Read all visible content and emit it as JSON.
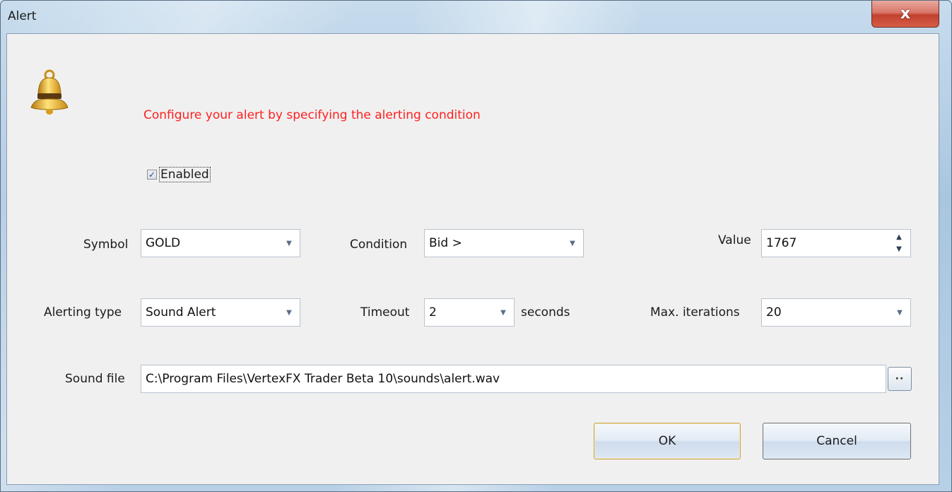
{
  "window": {
    "title": "Alert",
    "close_glyph": "x"
  },
  "header": {
    "icon": "bell-icon",
    "message": "Configure your alert by specifying the alerting condition",
    "message_color": "#ff2020"
  },
  "enabled": {
    "label": "Enabled",
    "checked": true,
    "check_glyph": "✓"
  },
  "symbol": {
    "label": "Symbol",
    "value": "GOLD"
  },
  "condition": {
    "label": "Condition",
    "value": "Bid >"
  },
  "value_field": {
    "label": "Value",
    "value": "1767"
  },
  "alerting_type": {
    "label": "Alerting type",
    "value": "Sound Alert"
  },
  "timeout": {
    "label": "Timeout",
    "value": "2",
    "unit": "seconds"
  },
  "max_iterations": {
    "label": "Max. iterations",
    "value": "20"
  },
  "sound_file": {
    "label": "Sound file",
    "value": "C:\\Program Files\\VertexFX Trader Beta 10\\sounds\\alert.wav",
    "browse_label": "··"
  },
  "buttons": {
    "ok": "OK",
    "cancel": "Cancel"
  }
}
